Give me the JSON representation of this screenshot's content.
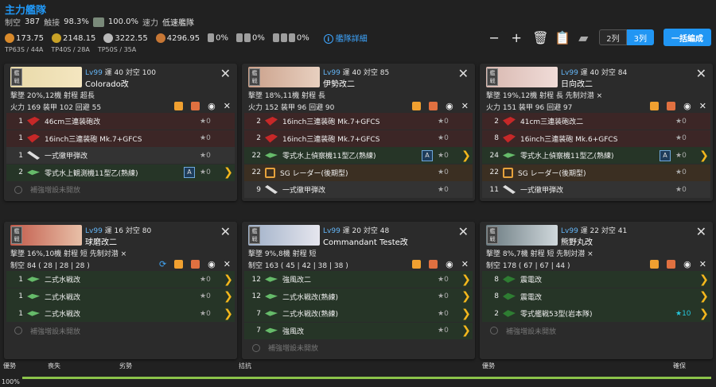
{
  "header": {
    "title": "主力艦隊",
    "air_power_label": "制空",
    "air_power": "387",
    "contact_label": "触接",
    "contact": "98.3%",
    "anti_air_rate": "100.0%",
    "speed_label": "速力",
    "speed": "低速艦隊",
    "resources": [
      "173.75",
      "2148.15",
      "3222.55",
      "4296.95"
    ],
    "drum_rates": [
      "0%",
      "0%",
      "0%"
    ],
    "detail_link": "艦隊詳細",
    "tp": [
      "TP63S / 44A",
      "TP40S / 28A",
      "TP50S / 35A"
    ]
  },
  "toolbar": {
    "col2": "2列",
    "col3": "3列",
    "bulk": "一括編成"
  },
  "ships": [
    {
      "lv": "Lv99",
      "luck": "運 40",
      "aa": "対空 100",
      "name": "Colorado改",
      "stats1": "撃墜 20%,12機  射程 超長",
      "stats2": "火力 169  装甲 102  回避 55",
      "slots": [
        {
          "cnt": "1",
          "name": "46cm三連装砲改",
          "star": "★0"
        },
        {
          "cnt": "1",
          "name": "16inch三連装砲 Mk.7+GFCS",
          "star": "★0"
        },
        {
          "cnt": "1",
          "name": "一式徹甲弾改",
          "star": "★0"
        },
        {
          "cnt": "2",
          "name": "零式水上観測機11型乙(熟練)",
          "star": "★0",
          "prof": "A"
        },
        {
          "cnt": "",
          "name": "補強増設未開放",
          "star": ""
        }
      ]
    },
    {
      "lv": "Lv99",
      "luck": "運 40",
      "aa": "対空 85",
      "name": "伊勢改二",
      "stats1": "撃墜 18%,11機  射程 長",
      "stats2": "火力 152  装甲 96  回避 90",
      "slots": [
        {
          "cnt": "2",
          "name": "16inch三連装砲 Mk.7+GFCS",
          "star": "★0"
        },
        {
          "cnt": "2",
          "name": "16inch三連装砲 Mk.7+GFCS",
          "star": "★0"
        },
        {
          "cnt": "22",
          "name": "零式水上偵察機11型乙(熟練)",
          "star": "★0",
          "prof": "A"
        },
        {
          "cnt": "22",
          "name": "SG レーダー(後期型)",
          "star": "★0"
        },
        {
          "cnt": "9",
          "name": "一式徹甲弾改",
          "star": "★0"
        },
        {
          "cnt": "",
          "name": "補強増設未開放",
          "star": ""
        }
      ]
    },
    {
      "lv": "Lv99",
      "luck": "運 40",
      "aa": "対空 84",
      "name": "日向改二",
      "stats1": "撃墜 19%,12機  射程 長  先制対潜 ×",
      "stats2": "火力 151  装甲 96  回避 97",
      "slots": [
        {
          "cnt": "2",
          "name": "41cm三連装砲改二",
          "star": "★0"
        },
        {
          "cnt": "8",
          "name": "16inch三連装砲 Mk.6+GFCS",
          "star": "★0"
        },
        {
          "cnt": "24",
          "name": "零式水上偵察機11型乙(熟練)",
          "star": "★0",
          "prof": "A"
        },
        {
          "cnt": "22",
          "name": "SG レーダー(後期型)",
          "star": "★0"
        },
        {
          "cnt": "11",
          "name": "一式徹甲弾改",
          "star": "★0"
        },
        {
          "cnt": "",
          "name": "補強増設未開放",
          "star": ""
        }
      ]
    },
    {
      "lv": "Lv99",
      "luck": "運 16",
      "aa": "対空 80",
      "name": "球磨改二",
      "stats1": "撃墜 16%,10機  射程 短  先制対潜 ×",
      "stats2": "制空 84 ( 28 | 28 | 28 )",
      "slots": [
        {
          "cnt": "1",
          "name": "二式水戦改",
          "star": "★0"
        },
        {
          "cnt": "1",
          "name": "二式水戦改",
          "star": "★0"
        },
        {
          "cnt": "1",
          "name": "二式水戦改",
          "star": "★0"
        },
        {
          "cnt": "",
          "name": "補強増設未開放",
          "star": ""
        }
      ]
    },
    {
      "lv": "Lv99",
      "luck": "運 20",
      "aa": "対空 48",
      "name": "Commandant Teste改",
      "stats1": "撃墜 9%,8機  射程 短",
      "stats2": "制空 163 ( 45 | 42 | 38 | 38 )",
      "slots": [
        {
          "cnt": "12",
          "name": "強風改二",
          "star": "★0"
        },
        {
          "cnt": "12",
          "name": "二式水戦改(熟練)",
          "star": "★0"
        },
        {
          "cnt": "7",
          "name": "二式水戦改(熟練)",
          "star": "★0"
        },
        {
          "cnt": "7",
          "name": "強風改",
          "star": "★0"
        },
        {
          "cnt": "",
          "name": "補強増設未開放",
          "star": ""
        }
      ]
    },
    {
      "lv": "Lv99",
      "luck": "運 22",
      "aa": "対空 41",
      "name": "熊野丸改",
      "stats1": "撃墜 8%,7機  射程 短  先制対潜 ×",
      "stats2": "制空 178 ( 67 | 67 | 44 )",
      "slots": [
        {
          "cnt": "8",
          "name": "震電改",
          "star": ""
        },
        {
          "cnt": "8",
          "name": "震電改",
          "star": ""
        },
        {
          "cnt": "2",
          "name": "零式艦戦53型(岩本隊)",
          "star": "★10"
        },
        {
          "cnt": "",
          "name": "補強増設未開放",
          "star": ""
        }
      ]
    }
  ],
  "ratings": {
    "labels": [
      "優勢",
      "喪失",
      "劣勢",
      "拮抗",
      "優勢",
      "確保"
    ],
    "percent": "100%",
    "fill": 1.0
  }
}
